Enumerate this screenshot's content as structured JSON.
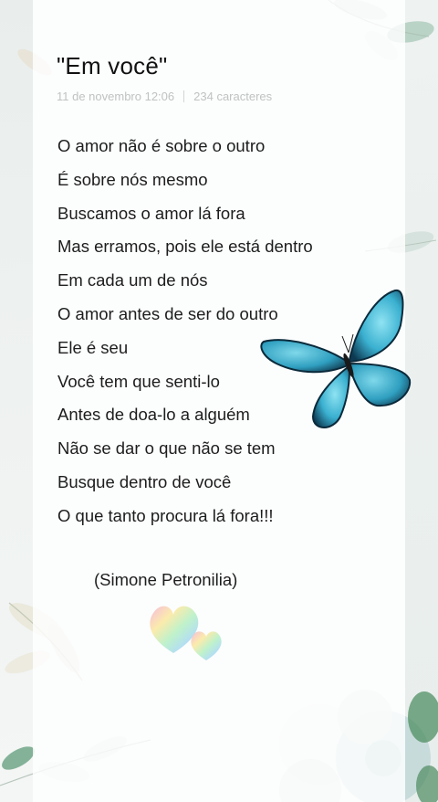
{
  "note": {
    "title": "\"Em você\"",
    "date": "11 de novembro 12:06",
    "char_count": "234 caracteres",
    "lines": [
      "O amor não é sobre o outro",
      "É sobre nós mesmo",
      "Buscamos o amor lá fora",
      "Mas erramos, pois ele está dentro",
      "Em cada um de nós",
      "O amor antes de ser do outro",
      "Ele é seu",
      "Você tem que senti-lo",
      "Antes de doa-lo a alguém",
      "Não se dar o que não se tem",
      "Busque dentro de você",
      "O que tanto procura lá fora!!!"
    ],
    "signature": "(Simone Petronilia)"
  },
  "theme": {
    "background": "#eef1f0",
    "text": "#1d1d1d",
    "meta_text": "#bfc3c2",
    "butterfly_blue": "#3fb6d4",
    "leaf_green": "#7fa98e"
  },
  "decorations": [
    "butterfly-sticker",
    "rainbow-hearts-sticker",
    "watercolor-flowers",
    "watercolor-leaves"
  ]
}
